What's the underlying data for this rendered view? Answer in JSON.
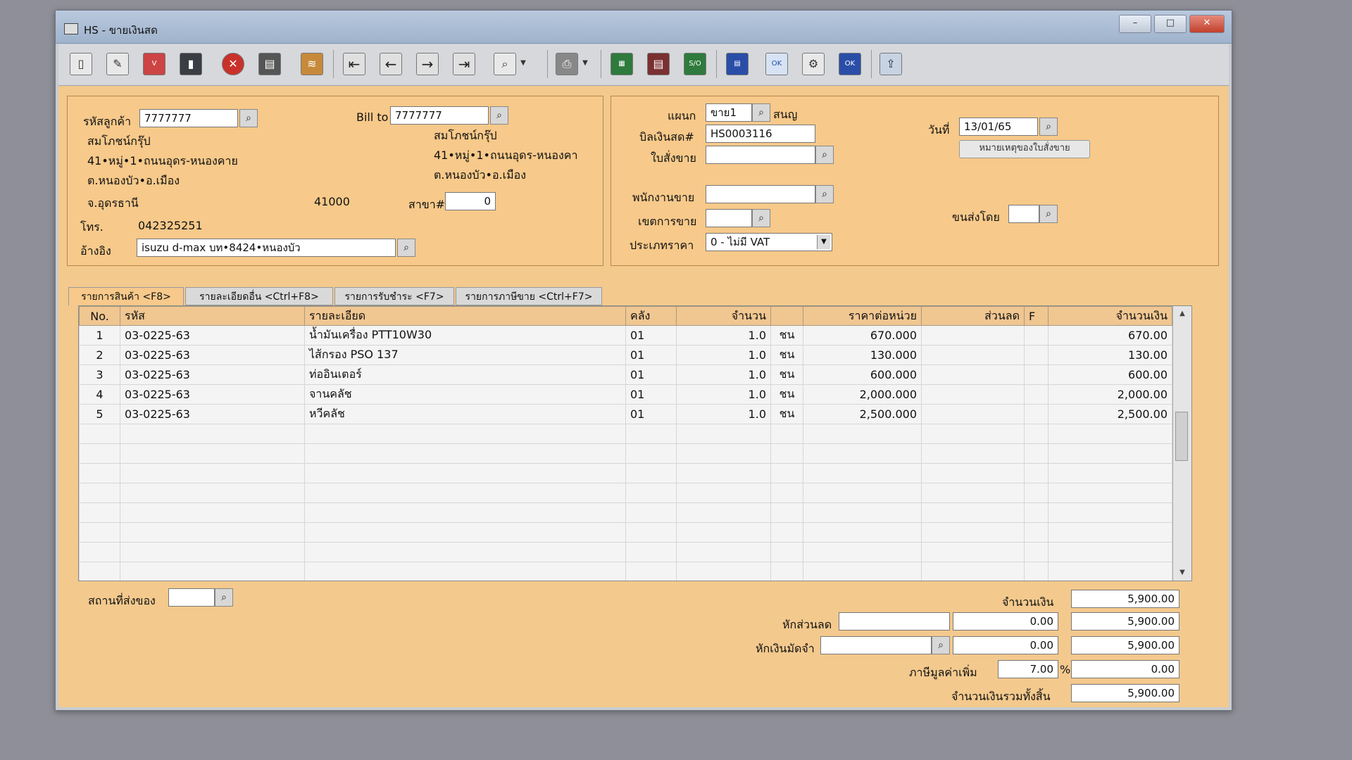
{
  "window": {
    "title": "HS - ขายเงินสด",
    "buttons": {
      "minimize": "–",
      "maximize": "□",
      "close": "✕"
    }
  },
  "toolbar": {
    "icons": [
      "new-icon",
      "edit-icon",
      "void-icon",
      "trash-icon",
      "cancel-icon",
      "save-icon",
      "stack-icon",
      "first-icon",
      "prev-icon",
      "next-icon",
      "last-icon",
      "search-icon",
      "printer-icon",
      "report-1-icon",
      "report-2-icon",
      "so-icon",
      "table-icon",
      "approve-icon",
      "tool-icon",
      "ok-icon",
      "export-icon"
    ]
  },
  "customer": {
    "code_label": "รหัสลูกค้า",
    "code": "7777777",
    "name": "สมโภชน์กรุ๊ป",
    "addr1": "41•หมู่•1•ถนนอุดร-หนองคาย",
    "addr2": "ต.หนองบัว•อ.เมือง",
    "province": "จ.อุดรธานี",
    "zip": "41000",
    "phone_label": "โทร.",
    "phone": "042325251",
    "ref_label": "อ้างอิง",
    "ref": "isuzu d-max บท•8424•หนองบัว",
    "branch_label": "สาขา#",
    "branch": "0"
  },
  "billto": {
    "label": "Bill to",
    "code": "7777777",
    "name": "สมโภชน์กรุ๊ป",
    "addr1": "41•หมู่•1•ถนนอุดร-หนองคา",
    "addr2": "ต.หนองบัว•อ.เมือง"
  },
  "doc": {
    "dept_label": "แผนก",
    "dept": "ขาย1",
    "dept_name": "สนญ",
    "bill_label": "บิลเงินสด#",
    "bill": "HS0003116",
    "so_label": "ใบสั่งขาย",
    "so": "",
    "date_label": "วันที่",
    "date": "13/01/65",
    "so_note_button": "หมายเหตุของใบสั่งขาย",
    "salesman_label": "พนักงานขาย",
    "salesman": "",
    "area_label": "เขตการขาย",
    "area": "",
    "ship_label": "ขนส่งโดย",
    "ship": "",
    "price_type_label": "ประเภทราคา",
    "price_type": "0 - ไม่มี VAT"
  },
  "tabs": [
    "รายการสินค้า <F8>",
    "รายละเอียดอื่น <Ctrl+F8>",
    "รายการรับชำระ <F7>",
    "รายการภาษีขาย <Ctrl+F7>"
  ],
  "grid": {
    "headers": [
      "No.",
      "รหัส",
      "รายละเอียด",
      "คลัง",
      "จำนวน",
      "",
      "ราคาต่อหน่วย",
      "ส่วนลด",
      "F",
      "จำนวนเงิน"
    ],
    "rows": [
      [
        "1",
        "03-0225-63",
        "น้ำมันเครื่อง PTT10W30",
        "01",
        "1.0",
        "ชน",
        "670.000",
        "",
        "",
        "670.00"
      ],
      [
        "2",
        "03-0225-63",
        "ไส้กรอง PSO 137",
        "01",
        "1.0",
        "ชน",
        "130.000",
        "",
        "",
        "130.00"
      ],
      [
        "3",
        "03-0225-63",
        "ท่ออินเตอร์",
        "01",
        "1.0",
        "ชน",
        "600.000",
        "",
        "",
        "600.00"
      ],
      [
        "4",
        "03-0225-63",
        "จานคลัช",
        "01",
        "1.0",
        "ชน",
        "2,000.000",
        "",
        "",
        "2,000.00"
      ],
      [
        "5",
        "03-0225-63",
        "หวีคลัช",
        "01",
        "1.0",
        "ชน",
        "2,500.000",
        "",
        "",
        "2,500.00"
      ]
    ],
    "empty_rows": 8
  },
  "footer": {
    "ship_place_label": "สถานที่ส่งของ",
    "ship_place": "",
    "amount_label": "จำนวนเงิน",
    "amount": "5,900.00",
    "discount_label": "หักส่วนลด",
    "discount_text": "",
    "discount": "0.00",
    "after_discount": "5,900.00",
    "deposit_label": "หักเงินมัดจำ",
    "deposit_ref": "",
    "deposit": "0.00",
    "after_deposit": "5,900.00",
    "vat_label": "ภาษีมูลค่าเพิ่ม",
    "vat_rate": "7.00",
    "vat_unit": "%",
    "vat": "0.00",
    "total_label": "จำนวนเงินรวมทั้งสิ้น",
    "total": "5,900.00"
  }
}
